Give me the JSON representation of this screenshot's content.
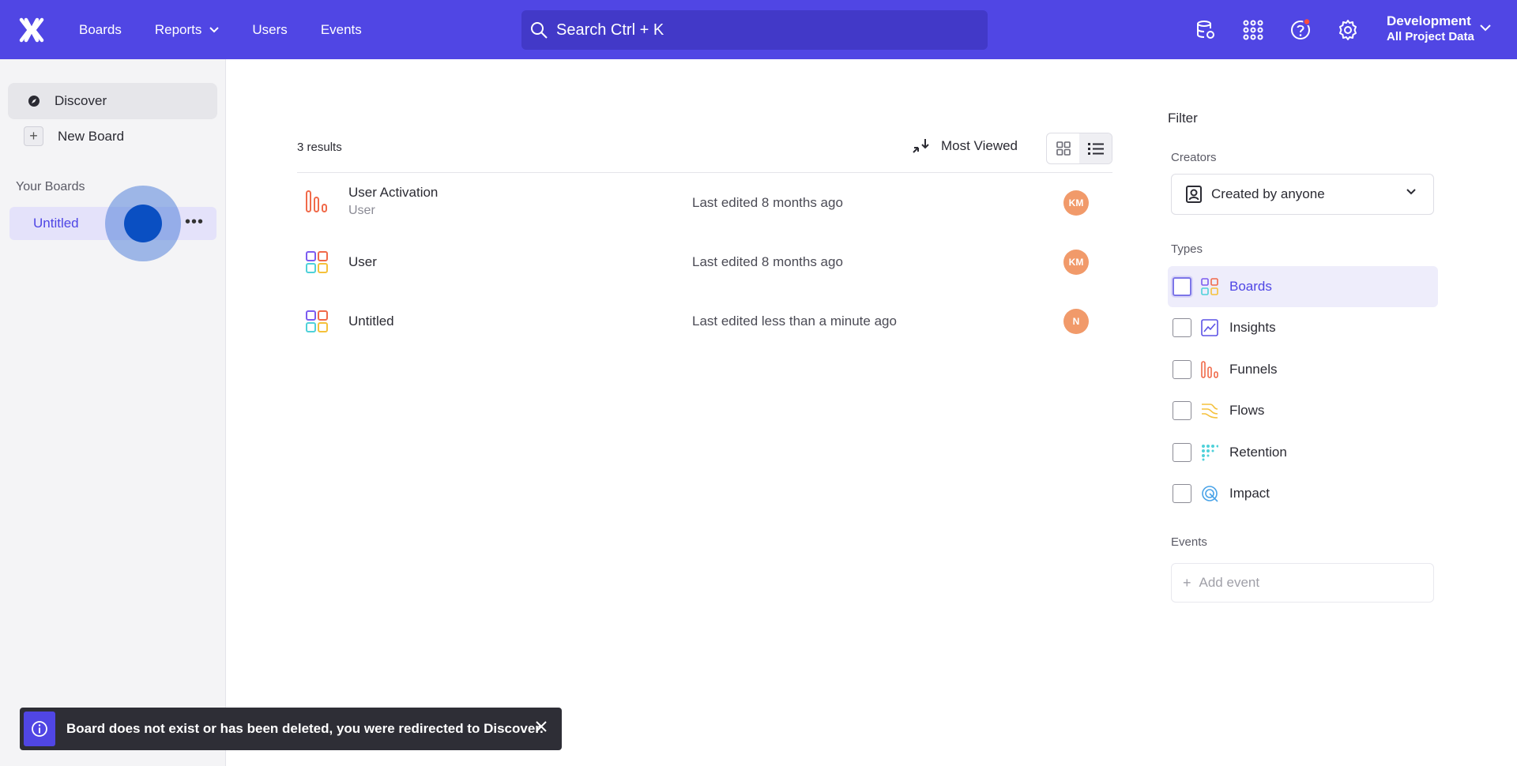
{
  "nav": {
    "items": [
      {
        "label": "Boards"
      },
      {
        "label": "Reports"
      },
      {
        "label": "Users"
      },
      {
        "label": "Events"
      }
    ],
    "search_text": "Search  Ctrl + K",
    "project_name": "Development",
    "project_scope": "All Project Data"
  },
  "sidebar": {
    "discover_label": "Discover",
    "new_board_label": "New Board",
    "section_title": "Your Boards",
    "boards": [
      {
        "label": "Untitled"
      }
    ]
  },
  "main": {
    "results_count": "3 results",
    "sort_label": "Most Viewed",
    "rows": [
      {
        "name": "User Activation",
        "subtitle": "User",
        "edited": "Last edited 8 months ago",
        "avatar": "KM",
        "icon": "funnel-icon"
      },
      {
        "name": "User",
        "subtitle": "",
        "edited": "Last edited 8 months ago",
        "avatar": "KM",
        "icon": "board-icon"
      },
      {
        "name": "Untitled",
        "subtitle": "",
        "edited": "Last edited less than a minute ago",
        "avatar": "N",
        "icon": "board-icon"
      }
    ]
  },
  "filter": {
    "title": "Filter",
    "creators_label": "Creators",
    "creators_value": "Created by anyone",
    "types_label": "Types",
    "types": [
      {
        "label": "Boards",
        "icon": "board-icon",
        "checked": false
      },
      {
        "label": "Insights",
        "icon": "insights-icon",
        "checked": false
      },
      {
        "label": "Funnels",
        "icon": "funnel-icon",
        "checked": false
      },
      {
        "label": "Flows",
        "icon": "flows-icon",
        "checked": false
      },
      {
        "label": "Retention",
        "icon": "retention-icon",
        "checked": false
      },
      {
        "label": "Impact",
        "icon": "impact-icon",
        "checked": false
      }
    ],
    "events_label": "Events",
    "add_event_placeholder": "Add event"
  },
  "toast": {
    "message": "Board does not exist or has been deleted, you were redirected to Discover."
  },
  "colors": {
    "brand": "#5046e4",
    "accent_text": "#4f46e5",
    "avatar": "#f19a6a"
  }
}
